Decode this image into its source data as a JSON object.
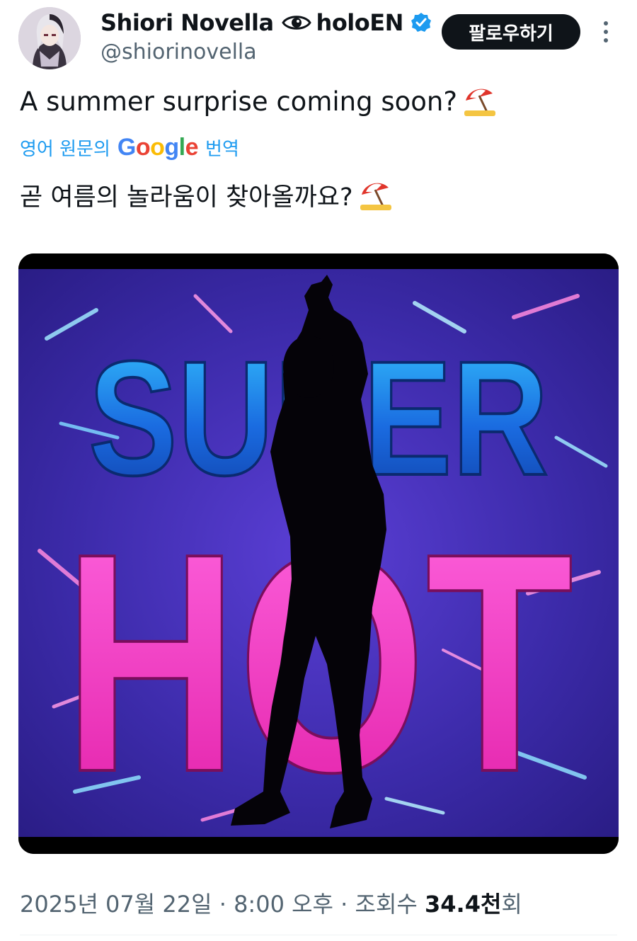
{
  "header": {
    "display_name": "Shiori Novella",
    "affiliation": "holoEN",
    "name_icon": "eye-icon",
    "verified_icon": "verified-badge-icon",
    "handle": "@shiorinovella",
    "follow_label": "팔로우하기",
    "more_icon": "more-vertical-icon"
  },
  "tweet": {
    "text_original": "A summer surprise coming soon?",
    "text_translated": "곧 여름의 놀라움이 찾아올까요?",
    "emoji_icon": "beach-umbrella-icon"
  },
  "translation": {
    "prefix": "영어 원문의",
    "provider": "Google",
    "suffix": "번역"
  },
  "media": {
    "line1": "SUPER",
    "line2": "HOT"
  },
  "meta": {
    "date": "2025년 07월 22일",
    "time": "8:00 오후",
    "views_label": "조회수",
    "views_count": "34.4천",
    "views_unit": "회",
    "separator": "·"
  },
  "colors": {
    "accent": "#1d9bf0",
    "text": "#0f1419",
    "muted": "#536471",
    "button_bg": "#0f1419"
  }
}
